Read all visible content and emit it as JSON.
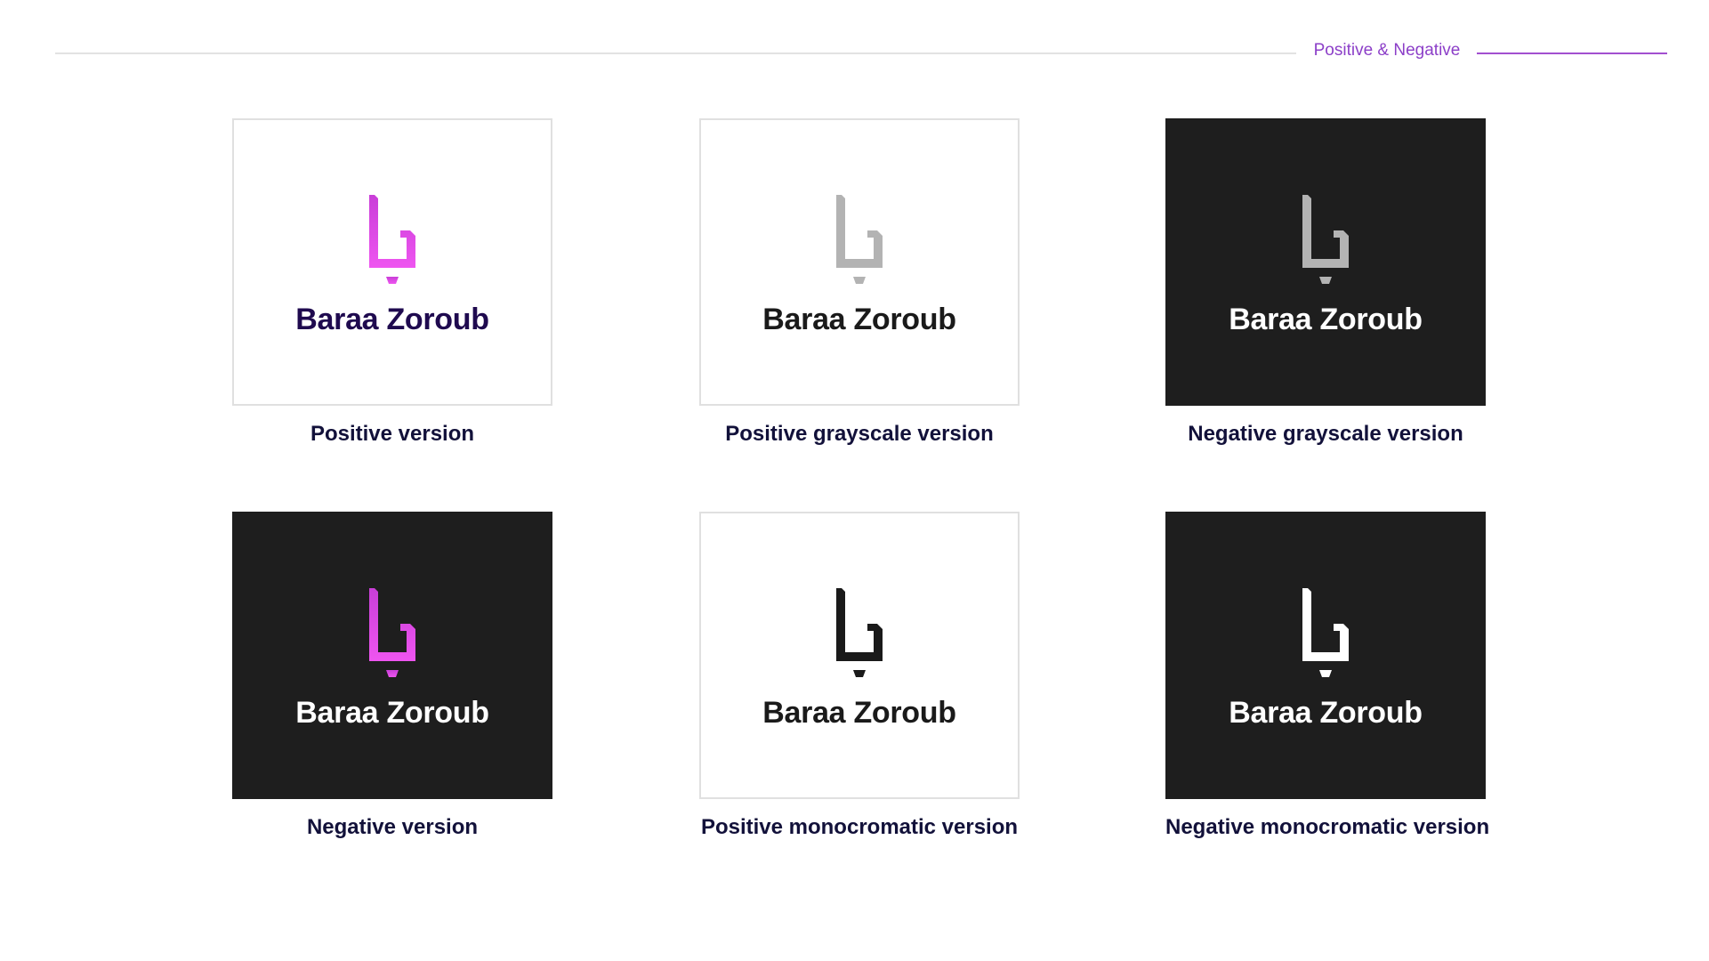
{
  "header": {
    "section_title": "Positive & Negative"
  },
  "brand": {
    "name": "Baraa Zoroub",
    "logo_icon": "baa-letter-mark-icon"
  },
  "colors": {
    "accent": "#a24fd0",
    "heading_text": "#12113a",
    "brand_dark_text": "#1f0a4f",
    "gradient_top": "#c93ed8",
    "gradient_bottom": "#ee55f0",
    "gray_mark": "#b3b3b3",
    "dark_background": "#1e1e1e",
    "white": "#ffffff",
    "black": "#1a1a1a"
  },
  "cards": [
    {
      "caption": "Positive version",
      "background": "white",
      "mark_color": "gradient",
      "name_color": "#1f0a4f"
    },
    {
      "caption": "Positive grayscale version",
      "background": "white",
      "mark_color": "#b3b3b3",
      "name_color": "#1a1a1a"
    },
    {
      "caption": "Negative grayscale version",
      "background": "#1e1e1e",
      "mark_color": "#b3b3b3",
      "name_color": "#ffffff"
    },
    {
      "caption": "Negative version",
      "background": "#1e1e1e",
      "mark_color": "gradient",
      "name_color": "#ffffff"
    },
    {
      "caption": "Positive monocromatic version",
      "background": "white",
      "mark_color": "#1a1a1a",
      "name_color": "#1a1a1a"
    },
    {
      "caption": "Negative monocromatic version",
      "background": "#1e1e1e",
      "mark_color": "#ffffff",
      "name_color": "#ffffff"
    }
  ]
}
